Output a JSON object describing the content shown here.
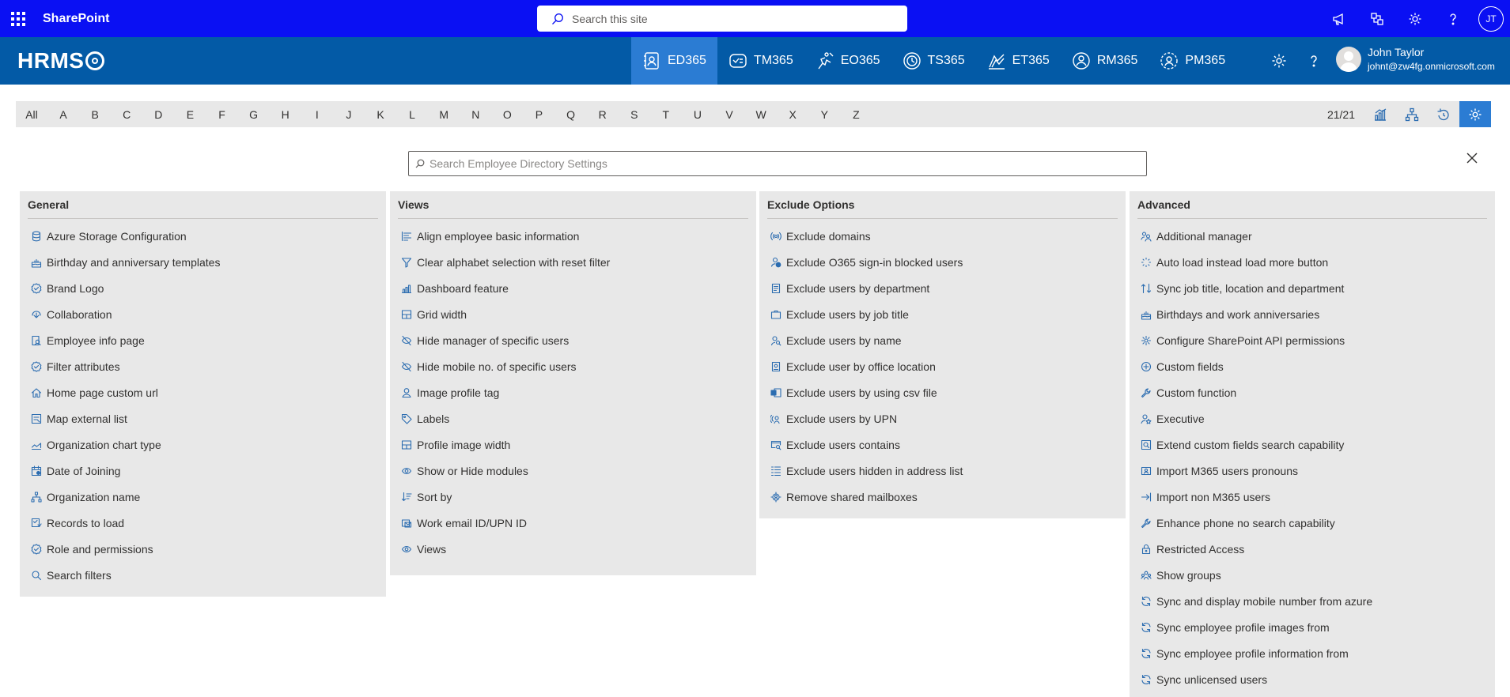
{
  "suite": {
    "app_name": "SharePoint",
    "search_placeholder": "Search this site",
    "initials": "JT"
  },
  "app": {
    "brand": "HRMS",
    "modules": [
      {
        "label": "ED365",
        "icon": "employee-directory-icon",
        "active": true
      },
      {
        "label": "TM365",
        "icon": "task-manager-icon"
      },
      {
        "label": "EO365",
        "icon": "onboarding-icon"
      },
      {
        "label": "TS365",
        "icon": "timesheet-clock-icon"
      },
      {
        "label": "ET365",
        "icon": "expense-tracker-icon"
      },
      {
        "label": "RM365",
        "icon": "resource-user-icon"
      },
      {
        "label": "PM365",
        "icon": "performance-user-icon"
      }
    ],
    "user": {
      "name": "John Taylor",
      "email": "johnt@zw4fg.onmicrosoft.com"
    }
  },
  "alphabet": {
    "letters": [
      "All",
      "A",
      "B",
      "C",
      "D",
      "E",
      "F",
      "G",
      "H",
      "I",
      "J",
      "K",
      "L",
      "M",
      "N",
      "O",
      "P",
      "Q",
      "R",
      "S",
      "T",
      "U",
      "V",
      "W",
      "X",
      "Y",
      "Z"
    ],
    "count": "21/21"
  },
  "settings": {
    "search_placeholder": "Search Employee Directory Settings",
    "columns": [
      {
        "title": "General",
        "items": [
          {
            "label": "Azure Storage Configuration",
            "icon": "database-icon"
          },
          {
            "label": "Birthday and anniversary templates",
            "icon": "cake-icon"
          },
          {
            "label": "Brand Logo",
            "icon": "badge-check-icon"
          },
          {
            "label": "Collaboration",
            "icon": "collaboration-icon"
          },
          {
            "label": "Employee info page",
            "icon": "person-document-icon"
          },
          {
            "label": "Filter attributes",
            "icon": "badge-check-icon"
          },
          {
            "label": "Home page custom url",
            "icon": "home-icon"
          },
          {
            "label": "Map external list",
            "icon": "map-list-icon"
          },
          {
            "label": "Organization chart type",
            "icon": "chart-area-icon"
          },
          {
            "label": "Date of Joining",
            "icon": "calendar-icon"
          },
          {
            "label": "Organization name",
            "icon": "org-chart-icon"
          },
          {
            "label": "Records to load",
            "icon": "records-icon"
          },
          {
            "label": "Role and permissions",
            "icon": "badge-check-icon"
          },
          {
            "label": "Search filters",
            "icon": "search-icon"
          }
        ]
      },
      {
        "title": "Views",
        "items": [
          {
            "label": "Align employee basic information",
            "icon": "align-icon"
          },
          {
            "label": "Clear alphabet selection with reset filter",
            "icon": "filter-icon"
          },
          {
            "label": "Dashboard feature",
            "icon": "dashboard-chart-icon"
          },
          {
            "label": "Grid width",
            "icon": "grid-icon"
          },
          {
            "label": "Hide manager of specific users",
            "icon": "eye-hide-icon"
          },
          {
            "label": "Hide mobile no. of specific users",
            "icon": "eye-hide-icon"
          },
          {
            "label": "Image profile tag",
            "icon": "person-icon"
          },
          {
            "label": "Labels",
            "icon": "tag-icon"
          },
          {
            "label": "Profile image width",
            "icon": "grid-icon"
          },
          {
            "label": "Show or Hide modules",
            "icon": "eye-icon"
          },
          {
            "label": "Sort by",
            "icon": "sort-icon"
          },
          {
            "label": "Work email ID/UPN ID",
            "icon": "mail-icon"
          },
          {
            "label": "Views",
            "icon": "eye-icon"
          }
        ]
      },
      {
        "title": "Exclude Options",
        "items": [
          {
            "label": "Exclude domains",
            "icon": "broadcast-icon"
          },
          {
            "label": "Exclude O365 sign-in blocked users",
            "icon": "person-blocked-icon"
          },
          {
            "label": "Exclude users by department",
            "icon": "document-icon"
          },
          {
            "label": "Exclude users by job title",
            "icon": "briefcase-icon"
          },
          {
            "label": "Exclude users by name",
            "icon": "person-search-icon"
          },
          {
            "label": "Exclude user by office location",
            "icon": "building-icon"
          },
          {
            "label": "Exclude users by using csv file",
            "icon": "excel-icon"
          },
          {
            "label": "Exclude users by UPN",
            "icon": "broadcast-person-icon"
          },
          {
            "label": "Exclude users contains",
            "icon": "window-search-icon"
          },
          {
            "label": "Exclude users hidden in address list",
            "icon": "list-icon"
          },
          {
            "label": "Remove shared mailboxes",
            "icon": "gear-person-icon"
          }
        ]
      },
      {
        "title": "Advanced",
        "items": [
          {
            "label": "Additional manager",
            "icon": "people-icon"
          },
          {
            "label": "Auto load instead load more button",
            "icon": "spinner-icon"
          },
          {
            "label": "Sync job title, location and department",
            "icon": "sync-arrows-icon"
          },
          {
            "label": "Birthdays and work anniversaries",
            "icon": "cake-icon"
          },
          {
            "label": "Configure SharePoint API permissions",
            "icon": "settings-link-icon"
          },
          {
            "label": "Custom fields",
            "icon": "add-circle-icon"
          },
          {
            "label": "Custom function",
            "icon": "wrench-icon"
          },
          {
            "label": "Executive",
            "icon": "person-star-icon"
          },
          {
            "label": "Extend custom fields search capability",
            "icon": "search-box-icon"
          },
          {
            "label": "Import M365 users pronouns",
            "icon": "contact-card-icon"
          },
          {
            "label": "Import non M365 users",
            "icon": "import-arrow-icon"
          },
          {
            "label": "Enhance phone no search capability",
            "icon": "wrench-icon"
          },
          {
            "label": "Restricted Access",
            "icon": "lock-icon"
          },
          {
            "label": "Show groups",
            "icon": "group-icon"
          },
          {
            "label": "Sync and display mobile number from azure",
            "icon": "sync-icon"
          },
          {
            "label": "Sync employee profile images from",
            "icon": "sync-icon"
          },
          {
            "label": "Sync employee profile information from",
            "icon": "sync-icon"
          },
          {
            "label": "Sync unlicensed users",
            "icon": "sync-icon"
          }
        ]
      }
    ]
  },
  "colors": {
    "suite_bar": "#0a10f3",
    "app_bar": "#035aa6",
    "active_module": "#2b7cd3",
    "icon_blue": "#2b6cb0",
    "panel": "#e8e8e8"
  }
}
